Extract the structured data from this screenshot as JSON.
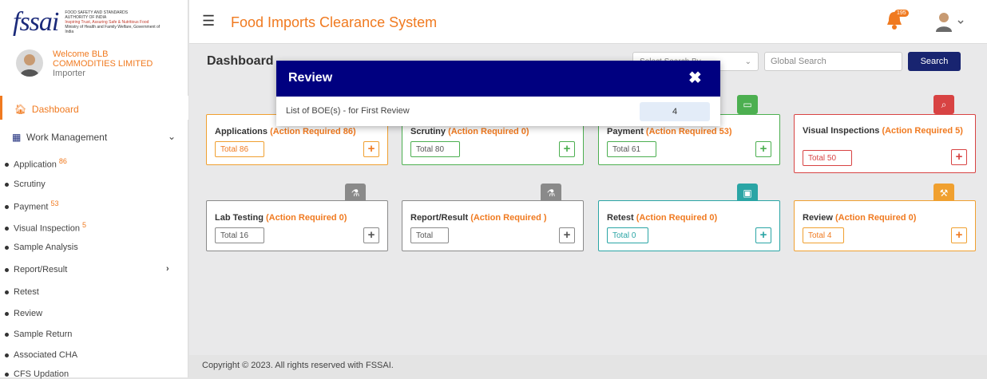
{
  "logo": {
    "brand": "fssai",
    "line1": "FOOD SAFETY AND STANDARDS",
    "line2": "AUTHORITY OF INDIA",
    "line3": "Inspiring Trust, Assuring Safe & Nutritious Food",
    "line4": "Ministry of Health and Family Welfare, Government of India"
  },
  "header": {
    "title": "Food Imports Clearance System",
    "notification_count": "195"
  },
  "sidebar": {
    "welcome": "Welcome BLB",
    "company": "COMMODITIES LIMITED",
    "role": "Importer",
    "dashboard": "Dashboard",
    "work_management": "Work Management",
    "items": [
      {
        "label": "Application",
        "count": "86"
      },
      {
        "label": "Scrutiny",
        "count": ""
      },
      {
        "label": "Payment",
        "count": "53"
      },
      {
        "label": "Visual Inspection",
        "count": "5"
      },
      {
        "label": "Sample Analysis",
        "count": ""
      },
      {
        "label": "Report/Result",
        "count": ""
      },
      {
        "label": "Retest",
        "count": ""
      },
      {
        "label": "Review",
        "count": ""
      },
      {
        "label": "Sample Return",
        "count": ""
      },
      {
        "label": "Associated CHA",
        "count": ""
      },
      {
        "label": "CFS Updation",
        "count": ""
      }
    ]
  },
  "main": {
    "title": "Dashboard",
    "search_by": "Select Search By",
    "global_search_placeholder": "Global Search",
    "search_button": "Search",
    "cards": [
      {
        "title": "Applications",
        "action": "(Action Required 86)",
        "total": "Total 86",
        "color": "#f0a030"
      },
      {
        "title": "Scrutiny",
        "action": "(Action Required 0)",
        "total": "Total 80",
        "color": "#4caf50"
      },
      {
        "title": "Payment",
        "action": "(Action Required 53)",
        "total": "Total 61",
        "color": "#4caf50"
      },
      {
        "title": "Visual Inspections",
        "action": "(Action Required 5)",
        "total": "Total 50",
        "color": "#d84343"
      },
      {
        "title": "Lab Testing",
        "action": "(Action Required 0)",
        "total": "Total 16",
        "color": "#8a8a8a"
      },
      {
        "title": "Report/Result",
        "action": "(Action Required )",
        "total": "Total",
        "color": "#8a8a8a"
      },
      {
        "title": "Retest",
        "action": "(Action Required 0)",
        "total": "Total 0",
        "color": "#2aa5a5"
      },
      {
        "title": "Review",
        "action": "(Action Required 0)",
        "total": "Total 4",
        "color": "#f0a030"
      }
    ]
  },
  "footer": {
    "text": "Copyright © 2023. All rights reserved with FSSAI."
  },
  "modal": {
    "title": "Review",
    "close": "✖",
    "row_label": "List of BOE(s) - for First Review",
    "row_value": "4"
  },
  "colors": {
    "accent": "#f07a20",
    "modal_header": "#000080",
    "search_button": "#182470"
  }
}
